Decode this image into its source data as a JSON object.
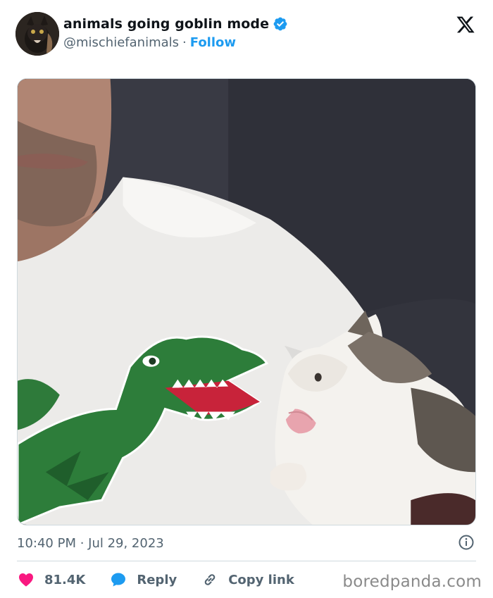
{
  "account": {
    "display_name": "animals going goblin mode",
    "handle": "@mischiefanimals",
    "separator": "·",
    "follow_label": "Follow",
    "verified": true
  },
  "icons": {
    "avatar": "avatar-image",
    "verified": "verified-badge-icon",
    "platform": "x-logo-icon",
    "info": "info-icon",
    "like": "heart-icon",
    "reply": "speech-bubble-icon",
    "copy": "link-icon"
  },
  "post": {
    "image_alt": "Kitten hissing at a crocodile logo on a man's white t-shirt",
    "timestamp": "10:40 PM · Jul 29, 2023"
  },
  "actions": {
    "like_count": "81.4K",
    "reply_label": "Reply",
    "copy_label": "Copy link"
  },
  "watermark": "boredpanda.com",
  "colors": {
    "accent": "#1d9bf0",
    "heart": "#f91880",
    "secondary_text": "#536471"
  }
}
